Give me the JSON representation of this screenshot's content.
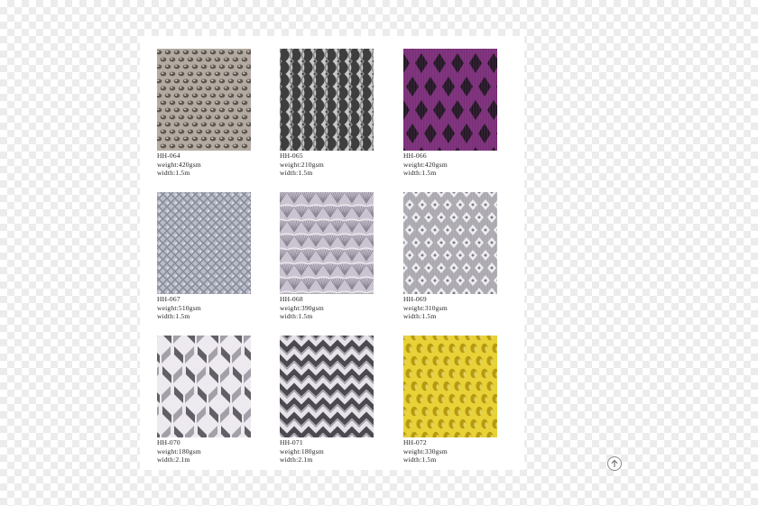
{
  "products": [
    {
      "code": "HH-064",
      "weight": "weight:420gsm",
      "width": "width:1.5m",
      "pattern": "dots",
      "colors": {
        "bg": "#b3aba1",
        "fg": "#5d5650",
        "hi": "#ddd6cc"
      }
    },
    {
      "code": "HH-065",
      "weight": "weight:210gsm",
      "width": "width:1.5m",
      "pattern": "waves",
      "colors": {
        "bg": "#3e3e3e",
        "fg": "#c8c8c8",
        "hi": "#8a8a8a"
      }
    },
    {
      "code": "HH-066",
      "weight": "weight:420gsm",
      "width": "width:1.5m",
      "pattern": "diamonds",
      "colors": {
        "bg": "#7a2f78",
        "fg": "#1e1620",
        "hi": "#a35aa0"
      }
    },
    {
      "code": "HH-067",
      "weight": "weight:510gsm",
      "width": "width:1.5m",
      "pattern": "lattice",
      "colors": {
        "bg": "#b9bcc8",
        "fg": "#868a98",
        "hi": "#dfe1ea"
      }
    },
    {
      "code": "HH-068",
      "weight": "weight:390gsm",
      "width": "width:1.5m",
      "pattern": "fans",
      "colors": {
        "bg": "#c9c4cf",
        "fg": "#8d8697",
        "hi": "#efedf2"
      }
    },
    {
      "code": "HH-069",
      "weight": "weight:310gsm",
      "width": "width:1.5m",
      "pattern": "lace",
      "colors": {
        "bg": "#b3b1b7",
        "fg": "#eeedf0",
        "hi": "#7e7b84"
      }
    },
    {
      "code": "HH-070",
      "weight": "weight:180gsm",
      "width": "width:2.1m",
      "pattern": "herringbone",
      "colors": {
        "bg": "#ece9ee",
        "fg": "#56535c",
        "hi": "#9d99a3"
      }
    },
    {
      "code": "HH-071",
      "weight": "weight:180gsm",
      "width": "width:2.1m",
      "pattern": "chevron",
      "colors": {
        "bg": "#e6e3e8",
        "fg": "#4c4951",
        "hi": "#9f9ba5"
      }
    },
    {
      "code": "HH-072",
      "weight": "weight:330gsm",
      "width": "width:1.5m",
      "pattern": "mesh",
      "colors": {
        "bg": "#e8d237",
        "fg": "#b69a10",
        "hi": "#f6e77a"
      }
    }
  ],
  "scroll_top_icon": "arrow-up-circle-icon"
}
